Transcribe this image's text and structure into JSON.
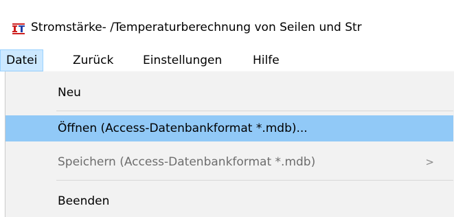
{
  "window": {
    "title": "Stromstärke- /Temperaturberechnung von Seilen und Str",
    "icon_name": "app-it-icon"
  },
  "menubar": {
    "items": [
      {
        "label": "Datei",
        "active": true
      },
      {
        "label": "Zurück",
        "active": false
      },
      {
        "label": "Einstellungen",
        "active": false
      },
      {
        "label": "Hilfe",
        "active": false
      }
    ]
  },
  "file_menu": {
    "items": [
      {
        "label": "Neu",
        "state": "normal"
      },
      {
        "label": "Öffnen (Access-Datenbankformat *.mdb)...",
        "state": "highlighted"
      },
      {
        "label": "Speichern (Access-Datenbankformat *.mdb)",
        "state": "disabled",
        "submenu_glyph": ">"
      },
      {
        "label": "Beenden",
        "state": "normal"
      }
    ]
  },
  "colors": {
    "menu_highlight": "#91c9f7",
    "menubar_active": "#cce8ff",
    "dropdown_bg": "#f2f2f2",
    "disabled_text": "#6d6d6d"
  }
}
